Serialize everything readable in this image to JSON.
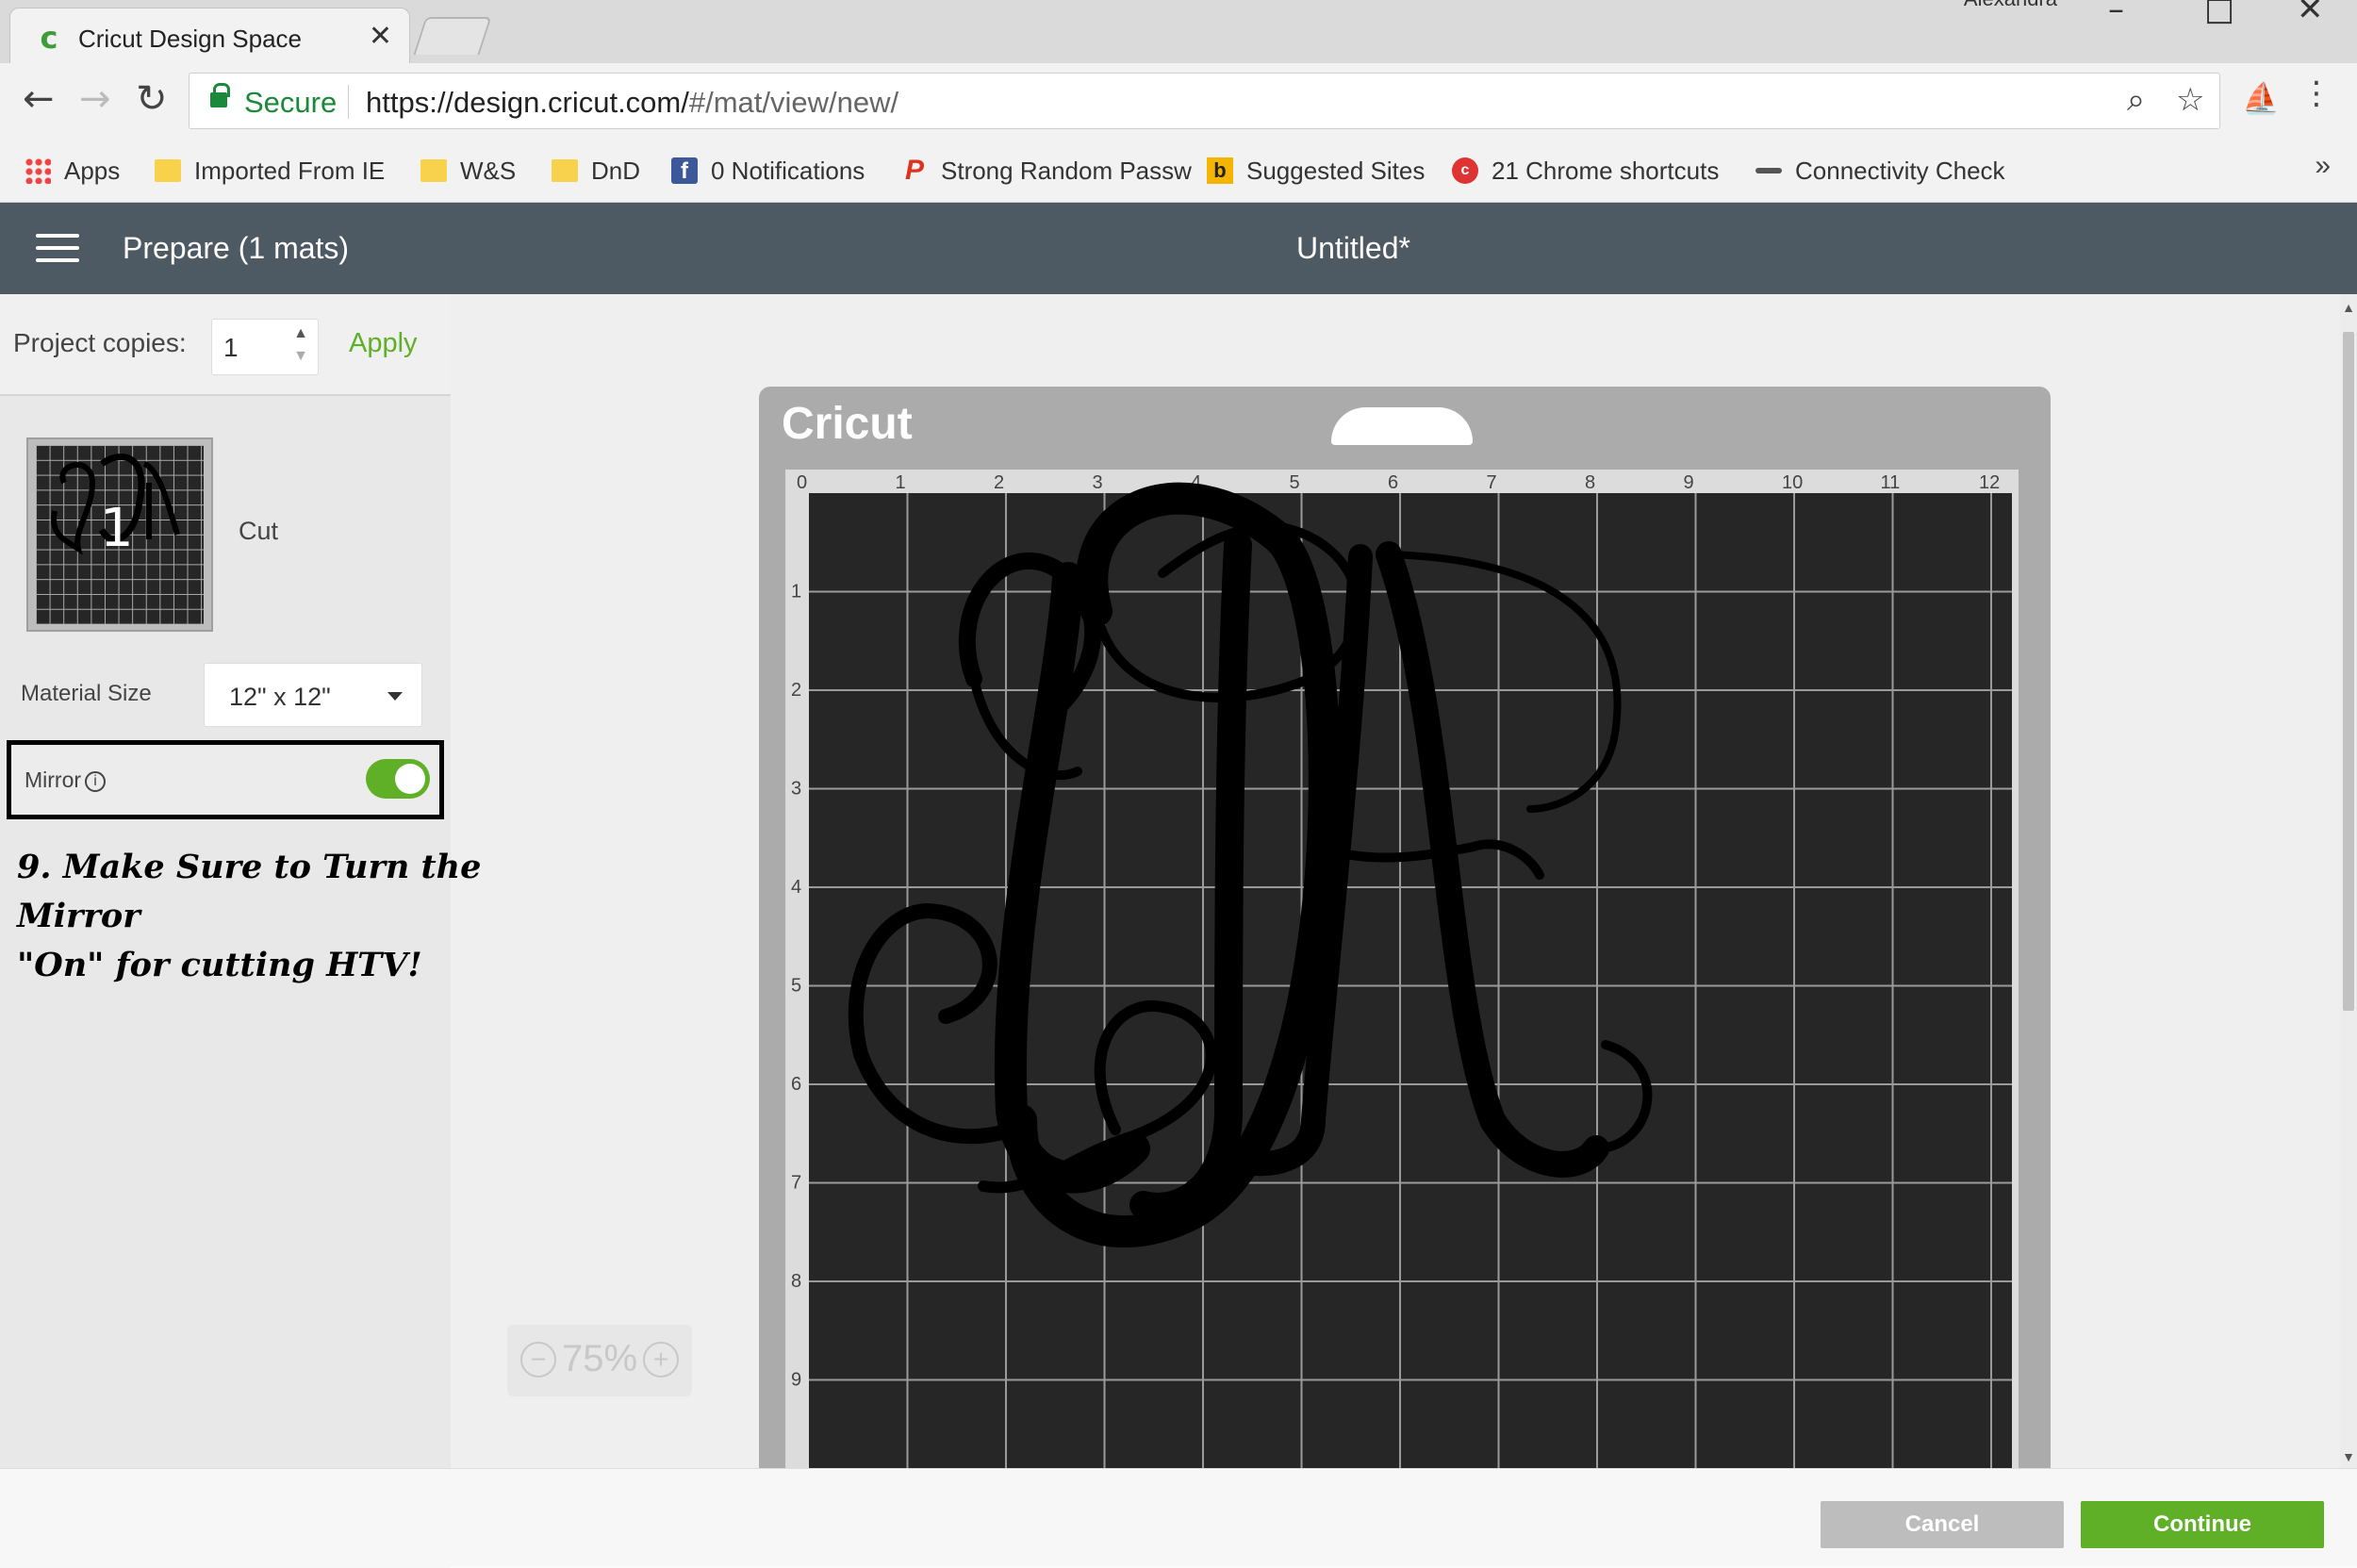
{
  "browser": {
    "tab_title": "Cricut Design Space",
    "tab_close": "✕",
    "user_name": "Alexandra",
    "secure_label": "Secure",
    "url_host": "https://design.cricut.com/",
    "url_path": "#/mat/view/new/",
    "bookmarks": [
      {
        "label": "Apps",
        "icon": "apps-icon"
      },
      {
        "label": "Imported From IE",
        "icon": "folder-icon"
      },
      {
        "label": "W&S",
        "icon": "folder-icon"
      },
      {
        "label": "DnD",
        "icon": "folder-icon"
      },
      {
        "label": "0 Notifications",
        "icon": "facebook-icon"
      },
      {
        "label": "Strong Random Passw",
        "icon": "lastpass-icon"
      },
      {
        "label": "Suggested Sites",
        "icon": "bing-icon"
      },
      {
        "label": "21 Chrome shortcuts",
        "icon": "chrome-shortcuts-icon"
      },
      {
        "label": "Connectivity Check",
        "icon": "connectivity-icon"
      }
    ],
    "bookmarks_more": "»"
  },
  "app": {
    "header_title": "Prepare (1 mats)",
    "document_title": "Untitled*"
  },
  "left_panel": {
    "copies_label": "Project copies:",
    "copies_value": "1",
    "apply_label": "Apply",
    "mat_number": "1",
    "mat_mode": "Cut",
    "material_label": "Material Size",
    "material_value": "12\" x 12\"",
    "mirror_label": "Mirror",
    "mirror_on": true,
    "note_line1": "9. Make Sure to Turn the Mirror",
    "note_line2": "\"On\" for cutting HTV!"
  },
  "mat": {
    "logo": "Cricut",
    "ruler_top": [
      "0",
      "1",
      "2",
      "3",
      "4",
      "5",
      "6",
      "7",
      "8",
      "9",
      "10",
      "11",
      "12"
    ],
    "ruler_left": [
      "1",
      "2",
      "3",
      "4",
      "5",
      "6",
      "7",
      "8",
      "9"
    ]
  },
  "zoom": {
    "value": "75%",
    "minus": "−",
    "plus": "+"
  },
  "footer": {
    "cancel_label": "Cancel",
    "continue_label": "Continue"
  },
  "colors": {
    "accent": "#5fb026",
    "header_bg": "#4e5a63",
    "mat_dark": "#262626"
  }
}
